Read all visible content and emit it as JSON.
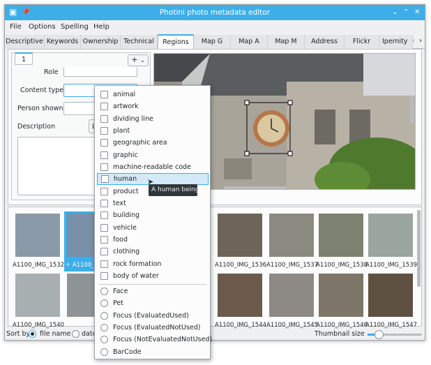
{
  "window": {
    "title": "Photini photo metadata editor"
  },
  "menu": [
    "File",
    "Options",
    "Spelling",
    "Help"
  ],
  "tabs": [
    "Descriptive",
    "Keywords",
    "Ownership",
    "Technical",
    "Regions",
    "Map G",
    "Map A",
    "Map M",
    "Address",
    "Flickr",
    "Ipernity"
  ],
  "active_tab": "Regions",
  "regions": {
    "region_tab": "1",
    "add_button": "+",
    "labels": {
      "role": "Role",
      "content_type": "Content type",
      "person_shown": "Person shown",
      "description": "Description"
    },
    "lang_button": "Lan"
  },
  "dropdown": {
    "checkbox_items": [
      "animal",
      "artwork",
      "dividing line",
      "plant",
      "geographic area",
      "graphic",
      "machine-readable code",
      "human",
      "product",
      "text",
      "building",
      "vehicle",
      "food",
      "clothing",
      "rock formation",
      "body of water"
    ],
    "highlighted": "human",
    "radio_items": [
      "Face",
      "Pet",
      "Focus (EvaluatedUsed)",
      "Focus (EvaluatedNotUsed)",
      "Focus (NotEvaluatedNotUsed)",
      "BarCode"
    ]
  },
  "tooltip": "A human being",
  "thumbnails": [
    {
      "name": "A1100_IMG_1532",
      "color": "#8a9aa8"
    },
    {
      "name": "A1100_IMG_1533",
      "color": "#7a8fa8",
      "selected": true
    },
    {
      "name": "A1100_IMG_1536",
      "color": "#6e6458"
    },
    {
      "name": "A1100_IMG_1537",
      "color": "#8b8a80"
    },
    {
      "name": "A1100_IMG_1538",
      "color": "#7d8270"
    },
    {
      "name": "A1100_IMG_1539",
      "color": "#9aa5a0"
    },
    {
      "name": "A1100_IMG_1540",
      "color": "#a8afb0"
    },
    {
      "name": "A1100_IMG_1544",
      "color": "#6b5a4c"
    },
    {
      "name": "A1100_IMG_1545",
      "color": "#8d8a85"
    },
    {
      "name": "A1100_IMG_1546",
      "color": "#7e7668"
    },
    {
      "name": "A1100_IMG_1547",
      "color": "#5e5142"
    }
  ],
  "thumb_partial": {
    "name": "A1100_IMG_1533",
    "prefix": "A1100_IMG_"
  },
  "status": {
    "sort_by": "Sort by",
    "file_name": "file name",
    "date": "date",
    "thumbnail_size": "Thumbnail size"
  },
  "colors": {
    "accent": "#3daee9",
    "window_bg": "#eff0f1",
    "tooltip_bg": "#31363b"
  }
}
